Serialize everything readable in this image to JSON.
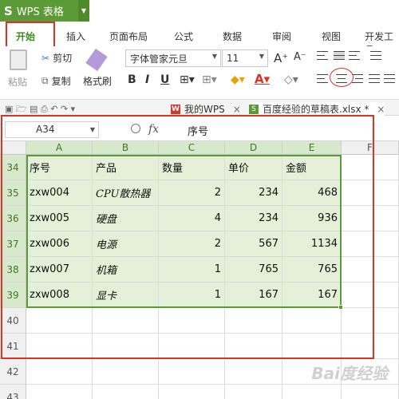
{
  "app": {
    "title": "WPS 表格"
  },
  "menu_tabs": [
    "开始",
    "插入",
    "页面布局",
    "公式",
    "数据",
    "审阅",
    "视图",
    "开发工具"
  ],
  "ribbon": {
    "paste": "粘贴",
    "cut": "剪切",
    "copy": "复制",
    "format_painter": "格式刷",
    "font_name": "字体管家元旦",
    "font_size": "11",
    "bold": "B",
    "italic": "I",
    "underline": "U",
    "grow_font": "A⁺",
    "shrink_font": "A⁻"
  },
  "doc_tabs": [
    {
      "label": "我的WPS"
    },
    {
      "label": "百度经验的草稿表.xlsx *"
    }
  ],
  "formula_bar": {
    "cell_ref": "A34",
    "fx": "fx",
    "value": "序号"
  },
  "columns": [
    "A",
    "B",
    "C",
    "D",
    "E",
    "F"
  ],
  "rows": [
    {
      "num": "34",
      "cells": [
        "序号",
        "产品",
        "数量",
        "单价",
        "金额"
      ]
    },
    {
      "num": "35",
      "cells": [
        "zxw004",
        "CPU散热器",
        "2",
        "234",
        "468"
      ]
    },
    {
      "num": "36",
      "cells": [
        "zxw005",
        "硬盘",
        "4",
        "234",
        "936"
      ]
    },
    {
      "num": "37",
      "cells": [
        "zxw006",
        "电源",
        "2",
        "567",
        "1134"
      ]
    },
    {
      "num": "38",
      "cells": [
        "zxw007",
        "机箱",
        "1",
        "765",
        "765"
      ]
    },
    {
      "num": "39",
      "cells": [
        "zxw008",
        "显卡",
        "1",
        "167",
        "167"
      ]
    },
    {
      "num": "40",
      "cells": [
        "",
        "",
        "",
        "",
        ""
      ]
    },
    {
      "num": "41",
      "cells": [
        "",
        "",
        "",
        "",
        ""
      ]
    },
    {
      "num": "42",
      "cells": [
        "",
        "",
        "",
        "",
        ""
      ]
    },
    {
      "num": "43",
      "cells": [
        "",
        "",
        "",
        "",
        ""
      ]
    }
  ],
  "watermark": "Bai度经验",
  "colors": {
    "accent": "#5b9a36",
    "highlight": "#d9332a",
    "selection": "#e4f1d8"
  }
}
